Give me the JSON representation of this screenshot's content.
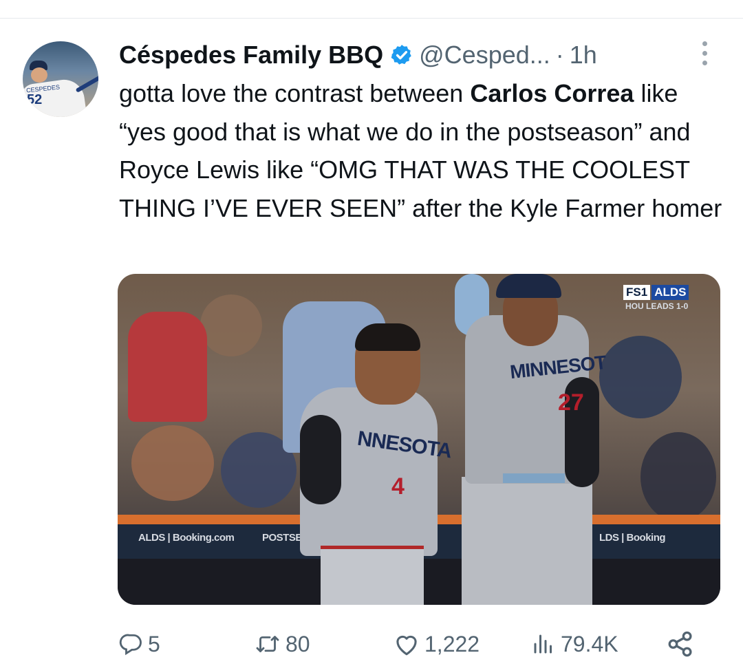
{
  "tweet": {
    "display_name": "Céspedes Family BBQ",
    "handle": "@Cesped...",
    "separator": "·",
    "time": "1h",
    "text": {
      "part1": "gotta love the contrast between ",
      "bold1": "Carlos Correa",
      "part2": " like “yes good that is what we do in the postseason” and Royce Lewis like “OMG THAT WAS THE COOLEST THING I’VE EVER SEEN” after the Kyle Farmer homer"
    }
  },
  "avatar": {
    "jersey_text": "CESPEDES",
    "jersey_number": "52"
  },
  "media": {
    "network_a": "FS1",
    "network_b": "ALDS",
    "score": "HOU LEADS 1-0",
    "ad_left": "ALDS | Booking.com",
    "ad_mid": "POSTSEA",
    "ad_right": "LDS | Booking",
    "jersey1_text": "NNESOTA",
    "jersey1_number": "4",
    "jersey2_text": "MINNESOT",
    "jersey2_number": "27"
  },
  "actions": {
    "replies": "5",
    "retweets": "80",
    "likes": "1,222",
    "views": "79.4K"
  },
  "colors": {
    "verified_blue": "#1d9bf0",
    "muted": "#536471",
    "text": "#0f1419"
  }
}
